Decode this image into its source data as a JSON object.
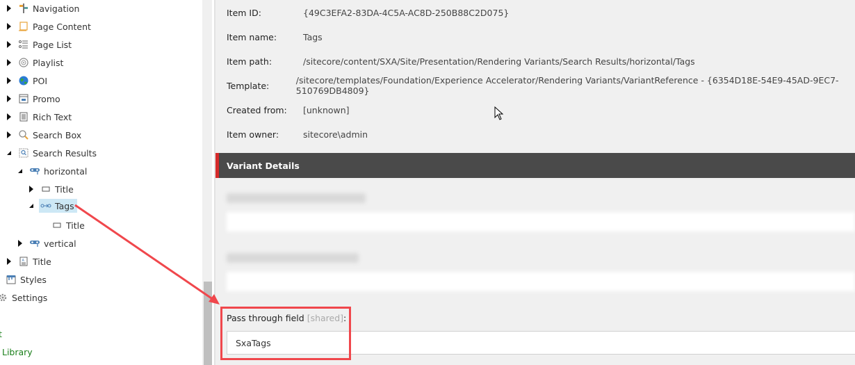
{
  "tree": {
    "items": [
      {
        "label": "Navigation",
        "icon": "signpost-icon",
        "toggle": "collapsed"
      },
      {
        "label": "Page Content",
        "icon": "scroll-icon",
        "toggle": "collapsed"
      },
      {
        "label": "Page List",
        "icon": "list-icon",
        "toggle": "collapsed"
      },
      {
        "label": "Playlist",
        "icon": "film-reel-icon",
        "toggle": "collapsed"
      },
      {
        "label": "POI",
        "icon": "globe-icon",
        "toggle": "collapsed"
      },
      {
        "label": "Promo",
        "icon": "promo-window-icon",
        "toggle": "collapsed"
      },
      {
        "label": "Rich Text",
        "icon": "document-text-icon",
        "toggle": "collapsed"
      },
      {
        "label": "Search Box",
        "icon": "magnifier-icon",
        "toggle": "collapsed"
      },
      {
        "label": "Search Results",
        "icon": "search-results-icon",
        "toggle": "expanded"
      },
      {
        "label": "horizontal",
        "icon": "mask-icon",
        "toggle": "expanded"
      },
      {
        "label": "Title",
        "icon": "field-box-icon",
        "toggle": "collapsed"
      },
      {
        "label": "Tags",
        "icon": "reference-link-icon",
        "toggle": "expanded",
        "selected": true
      },
      {
        "label": "Title",
        "icon": "field-box-icon",
        "toggle": "none"
      },
      {
        "label": "vertical",
        "icon": "mask-icon",
        "toggle": "collapsed"
      },
      {
        "label": "Title",
        "icon": "title-document-icon",
        "toggle": "collapsed"
      },
      {
        "label": "Styles",
        "icon": "styles-icon",
        "toggle": "none"
      },
      {
        "label": "Settings",
        "icon": "gear-icon",
        "toggle": "none"
      },
      {
        "label": "t",
        "icon": "",
        "toggle": "none"
      },
      {
        "label": "Library",
        "icon": "",
        "toggle": "none"
      }
    ]
  },
  "item_info": {
    "rows": [
      {
        "label": "Item ID:",
        "value": "{49C3EFA2-83DA-4C5A-AC8D-250B88C2D075}"
      },
      {
        "label": "Item name:",
        "value": "Tags"
      },
      {
        "label": "Item path:",
        "value": "/sitecore/content/SXA/Site/Presentation/Rendering Variants/Search Results/horizontal/Tags"
      },
      {
        "label": "Template:",
        "value": "/sitecore/templates/Foundation/Experience Accelerator/Rendering Variants/VariantReference - {6354D18E-54E9-45AD-9EC7-510769DB4809}"
      },
      {
        "label": "Created from:",
        "value": "[unknown]"
      },
      {
        "label": "Item owner:",
        "value": "sitecore\\admin"
      }
    ]
  },
  "variant_details": {
    "title": "Variant Details",
    "pass_through": {
      "label": "Pass through field",
      "shared_tag": "[shared]",
      "colon": ":",
      "value": "SxaTags"
    }
  },
  "colors": {
    "accent_red": "#d62b2b",
    "annotation_red": "#f0474c",
    "selection": "#cde8f5",
    "header_bg": "#4a4a4a"
  }
}
